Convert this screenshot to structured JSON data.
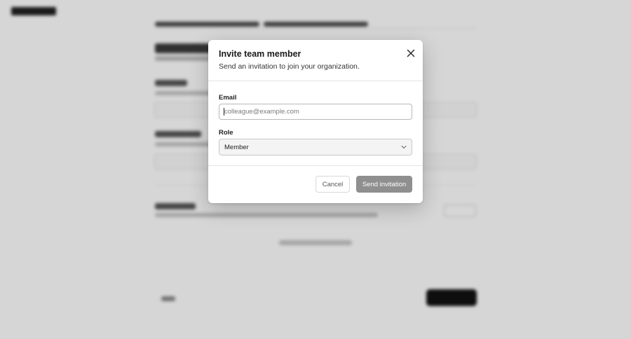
{
  "app": {
    "logo_name": "brand-logo"
  },
  "modal": {
    "title": "Invite team member",
    "description": "Send an invitation to join your organization.",
    "close_icon": "close-icon",
    "email": {
      "label": "Email",
      "value": "",
      "placeholder": "colleague@example.com"
    },
    "role": {
      "label": "Role",
      "selected": "Member",
      "icon": "chevron-down-icon"
    },
    "actions": {
      "cancel_label": "Cancel",
      "send_label": "Send invitation"
    }
  },
  "colors": {
    "overlay": "#00000029",
    "send_button": "#8f8f8f",
    "primary_dark": "#111111"
  }
}
